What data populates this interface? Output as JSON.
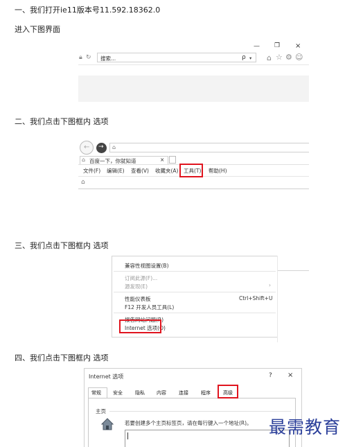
{
  "step1": {
    "text": "一、我们打开ie11版本号11.592.18362.0",
    "sub": "进入下图界面"
  },
  "shot1": {
    "search_placeholder": "搜索...",
    "search_icon_glyph": "ρ",
    "win_minimize": "—",
    "win_restore": "❐",
    "win_close": "×"
  },
  "step2": {
    "text": "二、我们点击下图框内 选项"
  },
  "shot2": {
    "tab_title": "百度一下，你就知道",
    "tab_close": "×",
    "menu": [
      "文件(F)",
      "编辑(E)",
      "查看(V)",
      "收藏夹(A)",
      "工具(T)",
      "帮助(H)"
    ]
  },
  "step3": {
    "text": "三、我们点击下图框内 选项"
  },
  "shot3": {
    "menu_items": [
      {
        "label": "兼容性视图设置(B)",
        "shortcut": "",
        "disabled": false
      },
      {
        "label": "订阅此源(F)...",
        "shortcut": "",
        "disabled": true
      },
      {
        "label": "源发现(E)",
        "shortcut": "›",
        "disabled": true
      },
      {
        "label": "性能仪表板",
        "shortcut": "Ctrl+Shift+U",
        "disabled": false
      },
      {
        "label": "F12 开发人员工具(L)",
        "shortcut": "",
        "disabled": false
      },
      {
        "label": "报告网站问题(R)",
        "shortcut": "",
        "disabled": false
      },
      {
        "label": "Internet 选项(O)",
        "shortcut": "",
        "disabled": false
      }
    ]
  },
  "step4": {
    "text": "四、我们点击下图框内 选项"
  },
  "shot4": {
    "dialog_title": "Internet 选项",
    "help_btn": "?",
    "close_btn": "×",
    "tabs": [
      "常规",
      "安全",
      "隐私",
      "内容",
      "连接",
      "程序",
      "高级"
    ],
    "section": "主页",
    "hint": "若要创建多个主页标签页，请在每行键入一个地址(R)。"
  },
  "watermark": "最需教育",
  "colors": {
    "highlight": "#e0141e",
    "watermark": "#2b3f9a"
  }
}
